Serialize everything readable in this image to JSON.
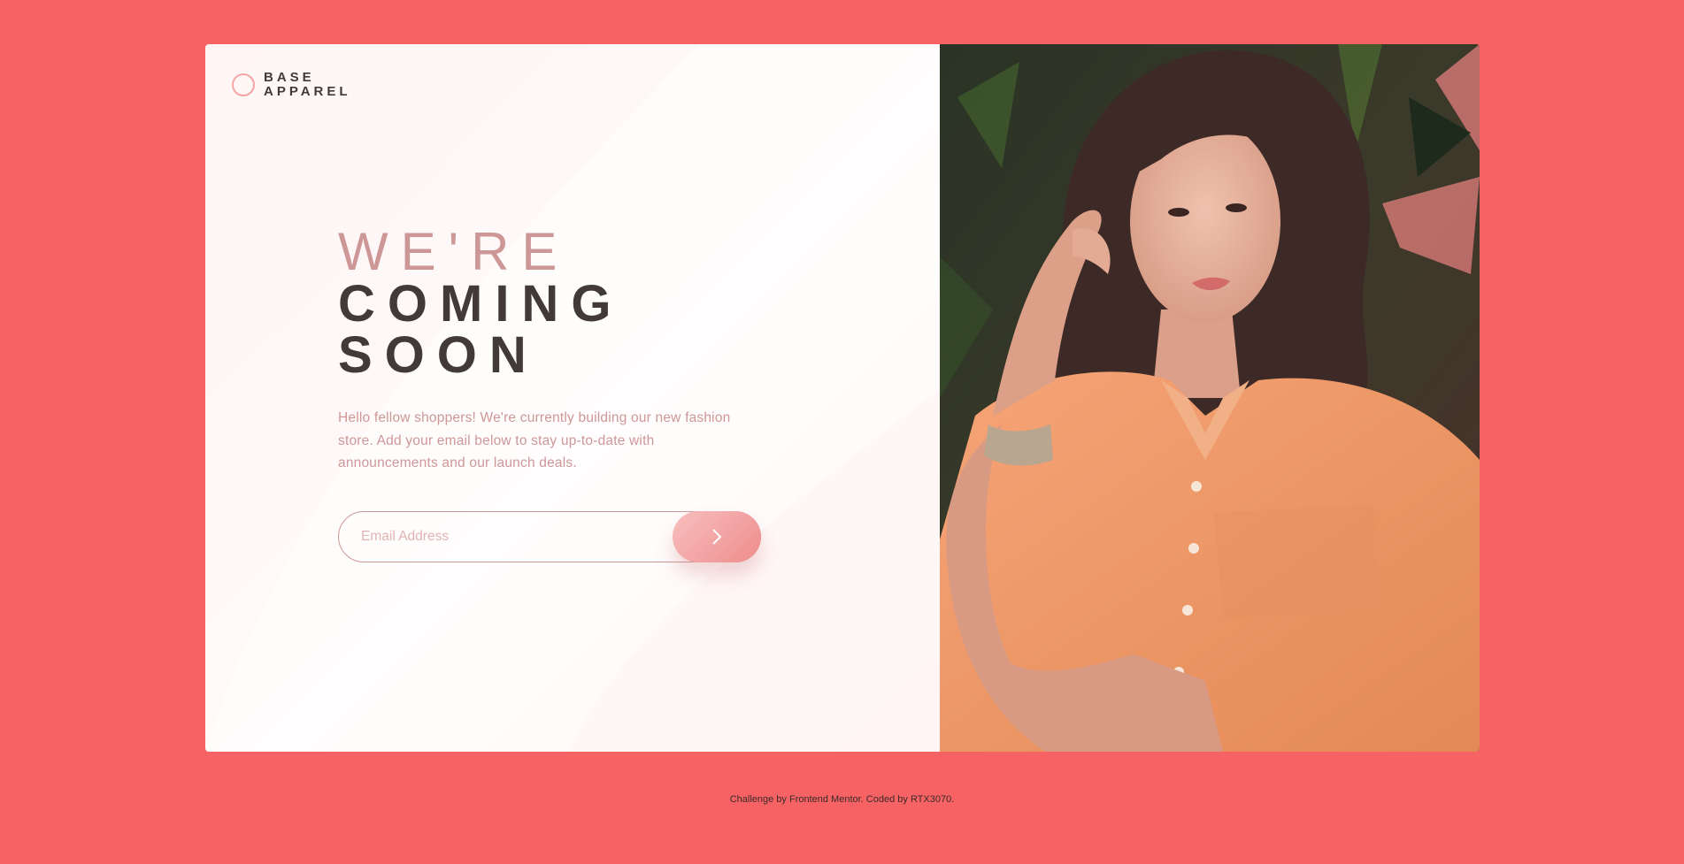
{
  "brand": {
    "line1": "BASE",
    "line2": "APPAREL",
    "accent_color": "#f4a6a6"
  },
  "hero": {
    "headline_light": "WE'RE",
    "headline_bold_1": "COMING",
    "headline_bold_2": "SOON",
    "description": "Hello fellow shoppers! We're currently building our new fashion store. Add your email below to stay up-to-date with announcements and our launch deals."
  },
  "form": {
    "email_placeholder": "Email Address",
    "email_value": "",
    "submit_icon": "chevron-right-icon"
  },
  "image": {
    "subject": "hero-photo"
  },
  "footer": {
    "text": "Challenge by Frontend Mentor. Coded by RTX3070."
  },
  "colors": {
    "page_background": "#f76364",
    "heading_dark": "#423a3a",
    "text_pink": "#ce9797",
    "button_gradient_start": "#f8bfbf",
    "button_gradient_end": "#ee8c8c"
  }
}
